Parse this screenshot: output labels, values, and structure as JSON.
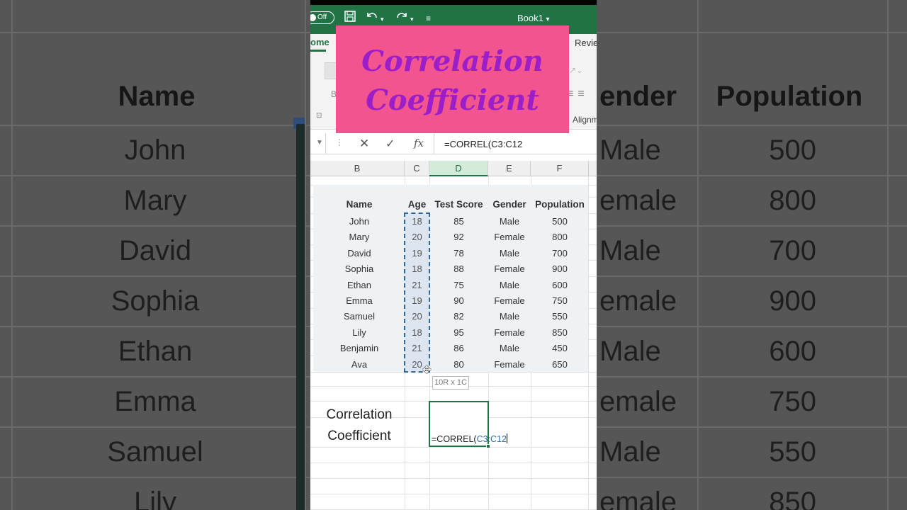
{
  "background": {
    "headers": {
      "name": "Name",
      "gender": "ender",
      "population": "Population"
    },
    "names": [
      "John",
      "Mary",
      "David",
      "Sophia",
      "Ethan",
      "Emma",
      "Samuel",
      "Lily"
    ],
    "genders": [
      "Male",
      "emale",
      "Male",
      "emale",
      "Male",
      "emale",
      "Male",
      "emale"
    ],
    "populations": [
      "500",
      "800",
      "700",
      "900",
      "600",
      "750",
      "550",
      "850"
    ]
  },
  "titlebar": {
    "autosave_label": "Off",
    "workbook": "Book1",
    "icons": [
      "toggle-icon",
      "save-icon",
      "undo-icon",
      "redo-icon",
      "customize-icon",
      "chevron-down-icon"
    ]
  },
  "ribbon": {
    "tab_home": "ome",
    "tab_review": "Revie",
    "bold_label": "B",
    "alignment_label": "Alignm"
  },
  "banner": {
    "line1": "Correlation",
    "line2": "Coefficient"
  },
  "formula_bar": {
    "cancel": "✕",
    "enter": "✓",
    "fx": "fx",
    "content": "=CORREL(C3:C12"
  },
  "columns": [
    "B",
    "C",
    "D",
    "E",
    "F"
  ],
  "table": {
    "headers": [
      "Name",
      "Age",
      "Test Score",
      "Gender",
      "Population"
    ],
    "rows": [
      [
        "John",
        "18",
        "85",
        "Male",
        "500"
      ],
      [
        "Mary",
        "20",
        "92",
        "Female",
        "800"
      ],
      [
        "David",
        "19",
        "78",
        "Male",
        "700"
      ],
      [
        "Sophia",
        "18",
        "88",
        "Female",
        "900"
      ],
      [
        "Ethan",
        "21",
        "75",
        "Male",
        "600"
      ],
      [
        "Emma",
        "19",
        "90",
        "Female",
        "750"
      ],
      [
        "Samuel",
        "20",
        "82",
        "Male",
        "550"
      ],
      [
        "Lily",
        "18",
        "95",
        "Female",
        "850"
      ],
      [
        "Benjamin",
        "21",
        "86",
        "Male",
        "450"
      ],
      [
        "Ava",
        "20",
        "80",
        "Female",
        "650"
      ]
    ]
  },
  "selection_tooltip": "10R x 1C",
  "correlation_label": {
    "line1": "Correlation",
    "line2": "Coefficient"
  },
  "active_cell": {
    "prefix": "=CORREL(",
    "ref": "C3:C12"
  },
  "colors": {
    "excel_green": "#217346",
    "banner_pink": "#f25490",
    "banner_text": "#9b1ec8",
    "ref_blue": "#2f6ea8"
  }
}
